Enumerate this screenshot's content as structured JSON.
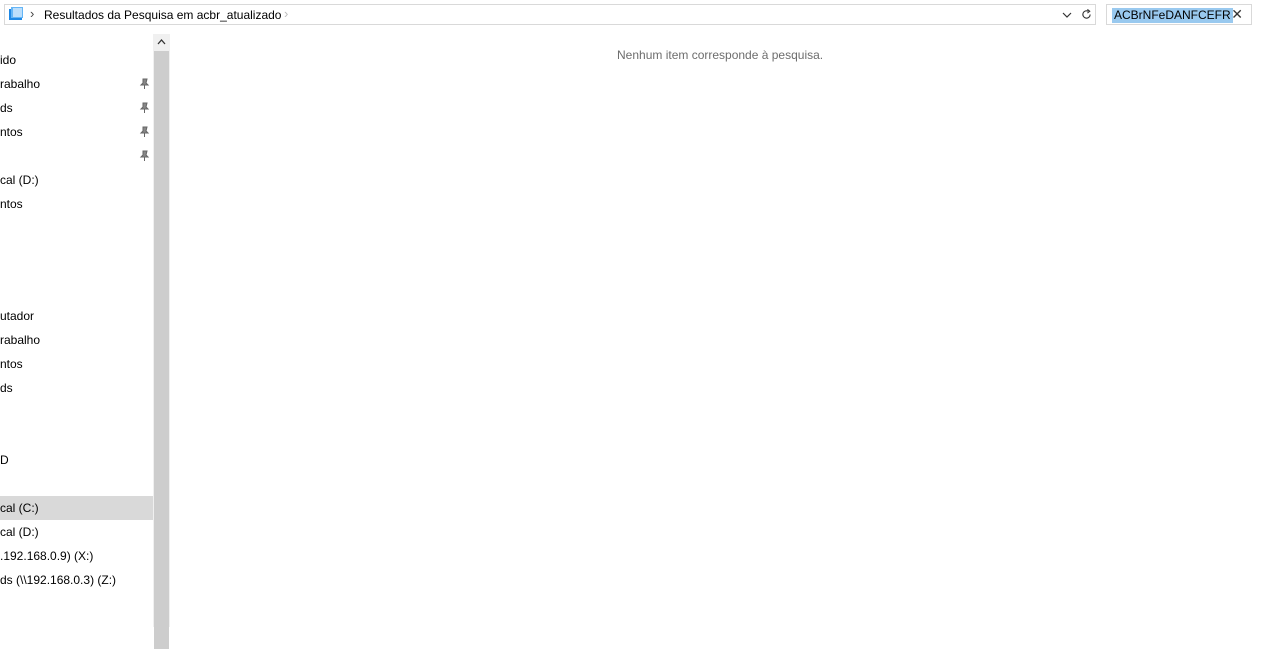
{
  "address_bar": {
    "breadcrumb": "Resultados da Pesquisa em acbr_atualizado",
    "separator": "›"
  },
  "search": {
    "value": "ACBrNFeDANFCEFR",
    "clear_glyph": "✕"
  },
  "nav": {
    "items": [
      {
        "label": "ido",
        "pinned": false
      },
      {
        "label": "rabalho",
        "pinned": true
      },
      {
        "label": "ds",
        "pinned": true
      },
      {
        "label": "ntos",
        "pinned": true
      },
      {
        "label": "",
        "pinned": true
      },
      {
        "label": "cal (D:)",
        "pinned": false
      },
      {
        "label": "ntos",
        "pinned": false
      },
      {
        "label": "utador",
        "pinned": false
      },
      {
        "label": "rabalho",
        "pinned": false
      },
      {
        "label": "ntos",
        "pinned": false
      },
      {
        "label": "ds",
        "pinned": false
      },
      {
        "label": "D",
        "pinned": false
      },
      {
        "label": "cal (C:)",
        "pinned": false,
        "selected": true
      },
      {
        "label": "cal (D:)",
        "pinned": false
      },
      {
        "label": ".192.168.0.9) (X:)",
        "pinned": false
      },
      {
        "label": "ds (\\\\192.168.0.3) (Z:)",
        "pinned": false
      }
    ]
  },
  "content": {
    "empty_message": "Nenhum item corresponde à pesquisa."
  },
  "icons": {
    "folder": "folder-icon",
    "dropdown": "chevron-down-icon",
    "refresh": "refresh-icon",
    "pin": "pin-icon",
    "scroll_up": "chevron-up-icon"
  }
}
